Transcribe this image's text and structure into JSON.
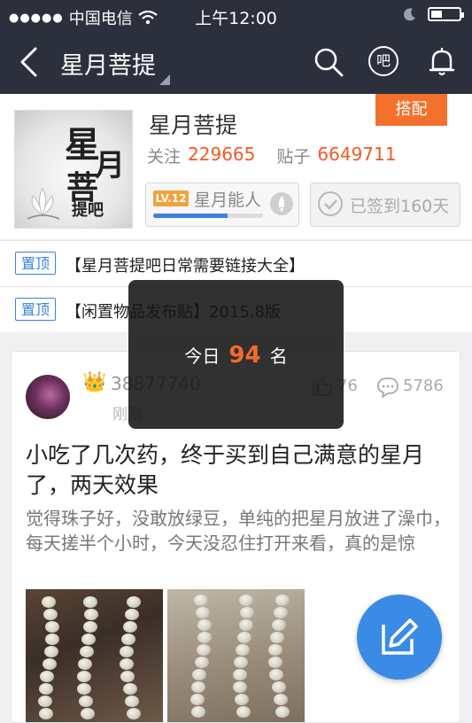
{
  "status_bar": {
    "carrier": "中国电信",
    "time": "上午12:00"
  },
  "nav": {
    "title": "星月菩提",
    "ba_icon_label": "吧"
  },
  "forum": {
    "name": "星月菩提",
    "avatar_text": {
      "line1": "星",
      "line2": "月",
      "line3": "菩",
      "line4": "提吧"
    },
    "follow_label": "关注",
    "follow_count": "229665",
    "posts_label": "贴子",
    "posts_count": "6649711",
    "collab_button": "搭配",
    "level_badge": "LV.12",
    "level_name": "星月能人",
    "level_progress": 0.68,
    "sign_text": "已签到160天"
  },
  "pinned": [
    {
      "tag": "置顶",
      "title": "【星月菩提吧日常需要链接大全】"
    },
    {
      "tag": "置顶",
      "title": "【闲置物品发布贴】2015.8版"
    }
  ],
  "post": {
    "username": "38877740",
    "time": "刚刚",
    "likes": "76",
    "comments": "5786",
    "title": "小吃了几次药，终于买到自己满意的星月了，两天效果",
    "body": "觉得珠子好，没敢放绿豆，单纯的把星月放进了澡巾，每天搓半个小时，今天没忍住打开来看，真的是惊"
  },
  "toast": {
    "prefix": "今日",
    "rank": "94",
    "suffix": "名"
  },
  "colors": {
    "nav_bg": "#2b303c",
    "accent_orange": "#f05a24",
    "accent_blue": "#3a8be6"
  }
}
